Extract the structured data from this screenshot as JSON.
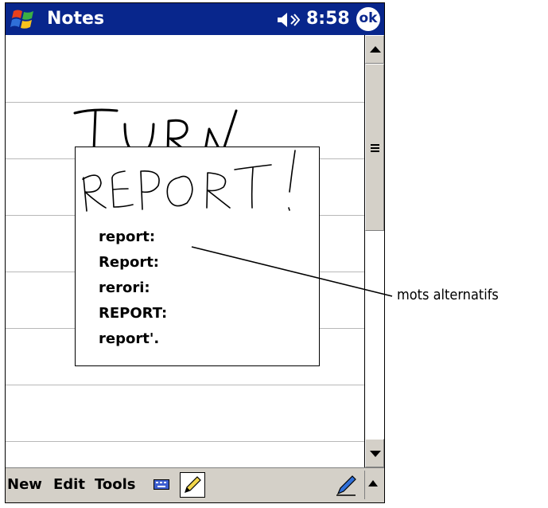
{
  "title_bar": {
    "app_title": "Notes",
    "time": "8:58",
    "ok_label": "ok",
    "start_icon": "windows-flag-icon",
    "volume_icon": "speaker-icon"
  },
  "note": {
    "handwritten_text": "TURN",
    "line_color": "#b8b8b8"
  },
  "alternates_popup": {
    "handwritten_word": "REPORT!",
    "alternates": [
      "report:",
      "Report:",
      "rerori:",
      "REPORT:",
      "report'."
    ]
  },
  "menu_bar": {
    "items": [
      "New",
      "Edit",
      "Tools"
    ],
    "keyboard_icon": "keyboard-icon",
    "pen_icon": "pen-icon",
    "input_panel_icon": "pen-icon",
    "input_panel_arrow": "arrow-up-icon"
  },
  "annotation": {
    "label": "mots alternatifs"
  },
  "colors": {
    "title_bar": "#08268c",
    "menu_bar": "#d4d0c8"
  }
}
